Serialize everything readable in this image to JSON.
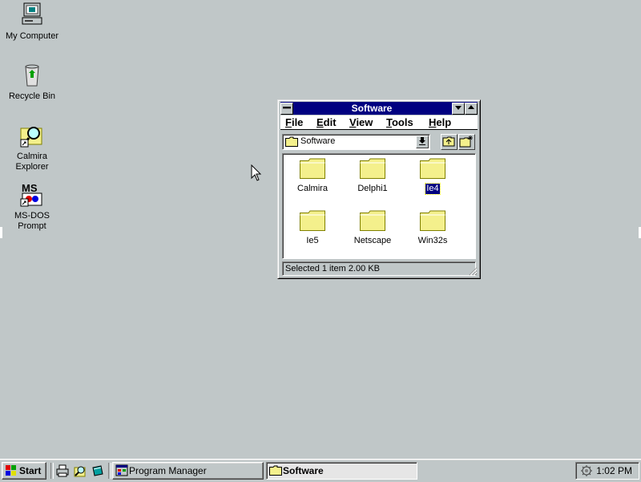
{
  "desktop": {
    "icons": [
      {
        "label_lines": [
          "My Computer"
        ]
      },
      {
        "label_lines": [
          "Recycle Bin"
        ]
      },
      {
        "label_lines": [
          "Calmira",
          "Explorer"
        ]
      },
      {
        "label_lines": [
          "MS-DOS",
          "Prompt"
        ]
      }
    ]
  },
  "window": {
    "title": "Software",
    "menu": [
      {
        "label": "File",
        "hotkey": "F",
        "rest": "ile"
      },
      {
        "label": "Edit",
        "hotkey": "E",
        "rest": "dit"
      },
      {
        "label": "View",
        "hotkey": "V",
        "rest": "iew"
      },
      {
        "label": "Tools",
        "hotkey": "T",
        "rest": "ools"
      },
      {
        "label": "Help",
        "hotkey": "H",
        "rest": "elp"
      }
    ],
    "address": "Software",
    "files": [
      {
        "name": "Calmira",
        "selected": false
      },
      {
        "name": "Delphi1",
        "selected": false
      },
      {
        "name": "Ie4",
        "selected": true
      },
      {
        "name": "Ie5",
        "selected": false
      },
      {
        "name": "Netscape",
        "selected": false
      },
      {
        "name": "Win32s",
        "selected": false
      }
    ],
    "status": "Selected 1 item  2.00 KB"
  },
  "taskbar": {
    "start_label": "Start",
    "tasks": [
      {
        "label": "Program Manager",
        "active": false
      },
      {
        "label": "Software",
        "active": true
      }
    ],
    "clock": "1:02 PM"
  },
  "colors": {
    "desktop": "#c0c7c8",
    "titlebar": "#000080",
    "folder": "#f4f08c"
  }
}
